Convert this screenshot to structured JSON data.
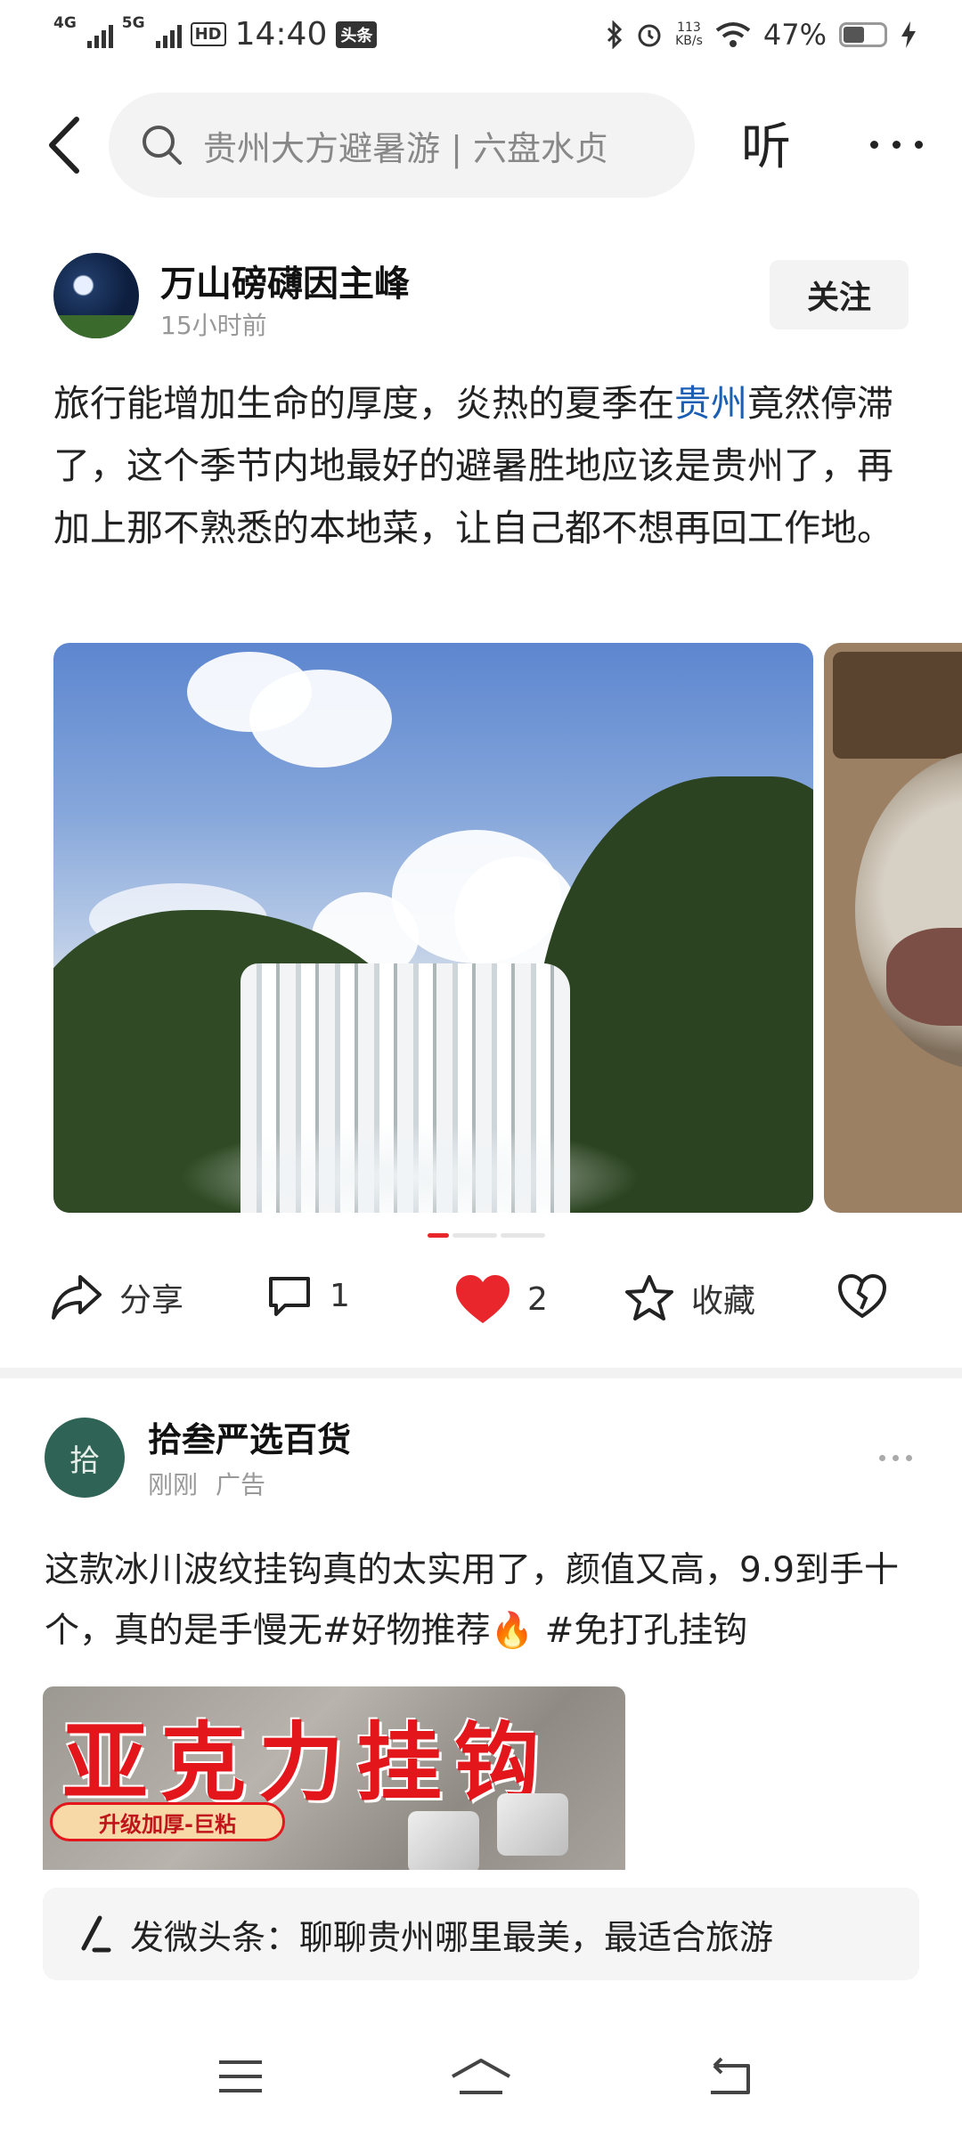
{
  "status_bar": {
    "signal1_label": "4G",
    "signal2_label": "5G",
    "hd_label": "HD",
    "time": "14:40",
    "app_badge": "头条",
    "net_speed_value": "113",
    "net_speed_unit": "KB/s",
    "battery_percent": "47%",
    "battery_level": 0.47
  },
  "header": {
    "search_text": "贵州大方避暑游 | 六盘水贞",
    "listen_label": "听"
  },
  "post1": {
    "author": "万山磅礴因主峰",
    "time": "15小时前",
    "follow_label": "关注",
    "text_before": "旅行能增加生命的厚度，炎热的夏季在",
    "text_link": "贵州",
    "text_after": "竟然停滞了，这个季节内地最好的避暑胜地应该是贵州了，再加上那不熟悉的本地菜，让自己都不想再回工作地。",
    "share_label": "分享",
    "comment_count": "1",
    "like_count": "2",
    "favorite_label": "收藏",
    "active_image_index": 1,
    "image_count": 3
  },
  "post2": {
    "author": "拾叁严选百货",
    "avatar_text": "拾",
    "time": "刚刚",
    "ad_label": "广告",
    "text_main": "这款冰川波纹挂钩真的太实用了，颜值又高，9.9到手十个，真的是手慢无#好物推荐",
    "text_tag": " #免打孔挂钩",
    "image_title": "亚克力挂钩",
    "image_badge": "升级加厚-巨粘"
  },
  "compose": {
    "text": "发微头条：聊聊贵州哪里最美，最适合旅游"
  },
  "colors": {
    "link": "#1a5fb4",
    "like_red": "#e8262b",
    "page_indicator_active": "#e8262b"
  }
}
